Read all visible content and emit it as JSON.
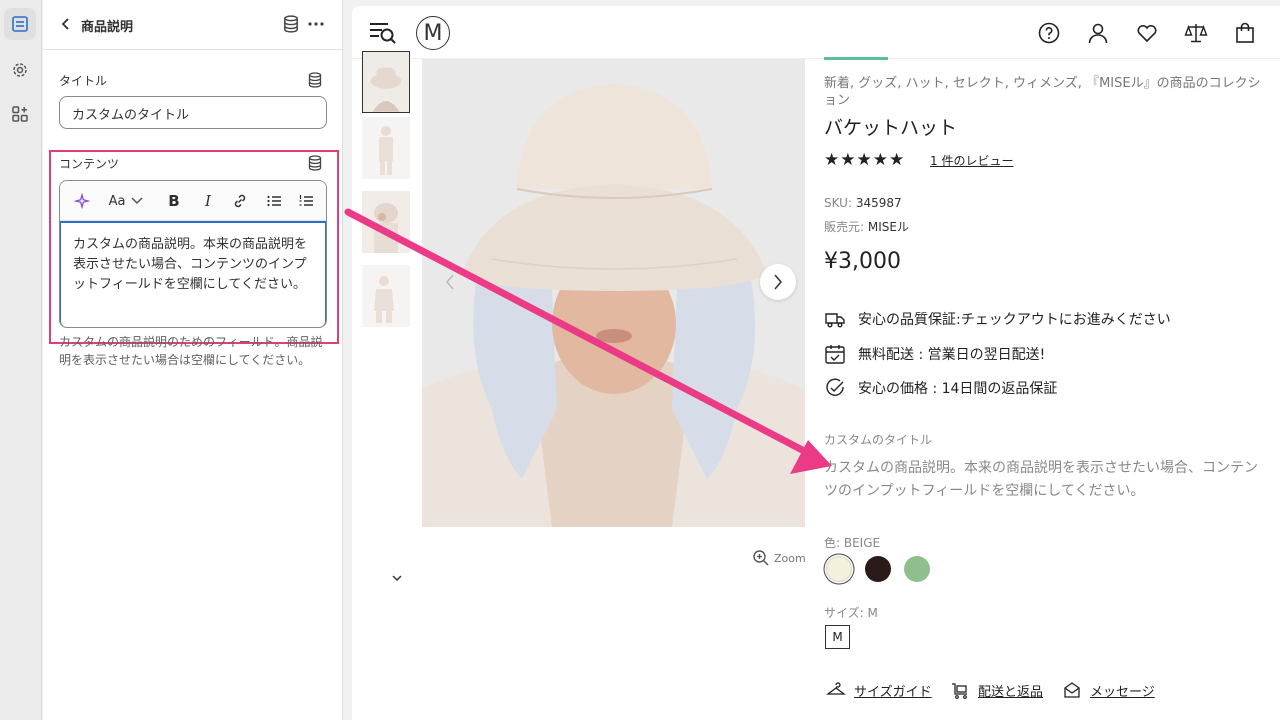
{
  "editor": {
    "panel_title": "商品説明",
    "title_field": {
      "label": "タイトル",
      "value": "カスタムのタイトル"
    },
    "content_field": {
      "label": "コンテンツ",
      "toolbar_font_label": "Aa",
      "value": "カスタムの商品説明。本来の商品説明を表示させたい場合、コンテンツのインプットフィールドを空欄にしてください。",
      "help_text": "カスタムの商品説明のためのフィールド。商品説明を表示させたい場合は空欄にしてください。"
    }
  },
  "preview": {
    "logo": "M",
    "collections": "新着, グッズ, ハット, セレクト, ウィメンズ, 『MISEル』の商品のコレクション",
    "product_title": "バケットハット",
    "stars": "★★★★★",
    "reviews_link": "1 件のレビュー",
    "sku_label": "SKU:",
    "sku_value": "345987",
    "vendor_label": "販売元:",
    "vendor_value": "MISEル",
    "price": "¥3,000",
    "features": [
      "安心の品質保証:チェックアウトにお進みください",
      "無料配送 : 営業日の翌日配送!",
      "安心の価格 : 14日間の返品保証"
    ],
    "custom_title": "カスタムのタイトル",
    "custom_description": "カスタムの商品説明。本来の商品説明を表示させたい場合、コンテンツのインプットフィールドを空欄にしてください。",
    "color_label": "色: BEIGE",
    "swatches": [
      {
        "name": "beige",
        "color": "#f3f0dc"
      },
      {
        "name": "dark-brown",
        "color": "#2a1a1a"
      },
      {
        "name": "sage-green",
        "color": "#8fbf8c"
      }
    ],
    "size_label": "サイズ: M",
    "size_value": "M",
    "zoom_label": "Zoom",
    "links": [
      "サイズガイド",
      "配送と返品",
      "メッセージ"
    ]
  },
  "colors": {
    "highlight": "#e0407a",
    "arrow": "#ec3b86",
    "focus_border": "#2c6ecb",
    "green_accent": "#5fbe9a"
  }
}
